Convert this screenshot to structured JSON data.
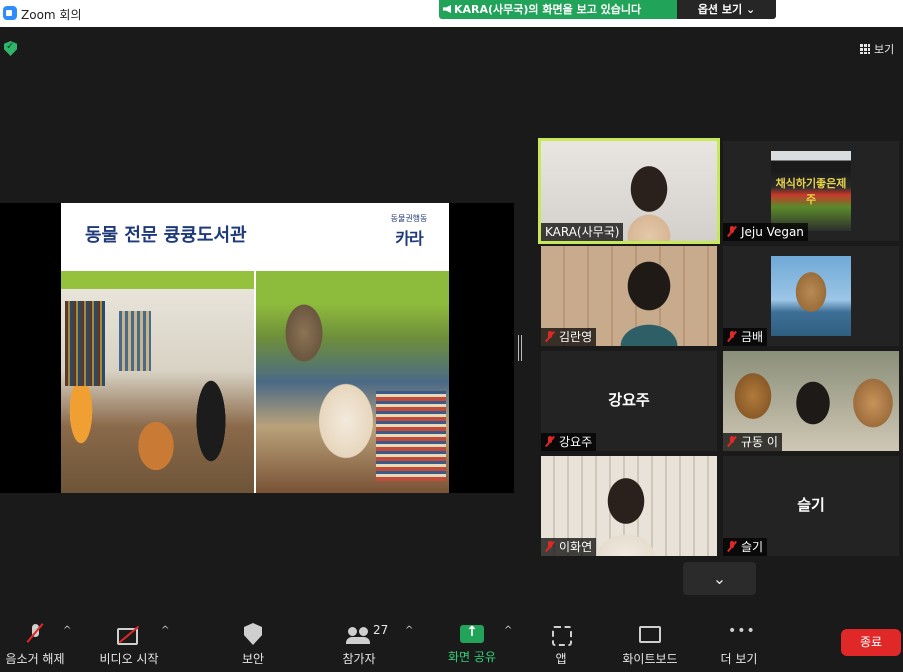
{
  "window": {
    "title": "Zoom 회의"
  },
  "banner": {
    "text": "KARA(사무국)의 화면을 보고 있습니다",
    "options_label": "옵션 보기"
  },
  "top_right": {
    "view_label": "보기"
  },
  "slide": {
    "title": "동물 전문 큥큥도서관",
    "brand_small": "동물권행동",
    "brand_large": "카라"
  },
  "participants": [
    {
      "name": "KARA(사무국)",
      "active": true,
      "video": true,
      "muted": false
    },
    {
      "name": "Jeju Vegan",
      "video": true,
      "muted": true,
      "caption": "채식하기좋은제주"
    },
    {
      "name": "김란영",
      "video": true,
      "muted": true
    },
    {
      "name": "금배",
      "video": true,
      "muted": true
    },
    {
      "name": "강요주",
      "video": false,
      "muted": true,
      "avatar_text": "강요주"
    },
    {
      "name": "규동 이",
      "video": true,
      "muted": true
    },
    {
      "name": "이화연",
      "video": true,
      "muted": true
    },
    {
      "name": "슬기",
      "video": false,
      "muted": true,
      "avatar_text": "슬기"
    }
  ],
  "toolbar": {
    "mute_label": "음소거 해제",
    "video_label": "비디오 시작",
    "security_label": "보안",
    "participants_label": "참가자",
    "participants_count": "27",
    "share_label": "화면 공유",
    "apps_label": "앱",
    "whiteboard_label": "화이트보드",
    "more_label": "더 보기",
    "end_label": "종료"
  },
  "colors": {
    "share_green": "#21a45a",
    "active_speaker": "#c7e85a",
    "end_red": "#e02828"
  }
}
